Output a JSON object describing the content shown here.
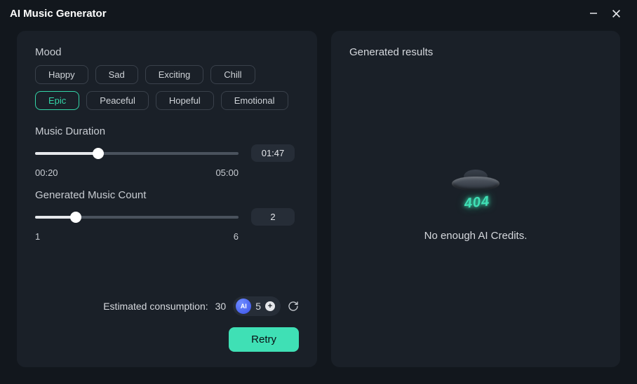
{
  "window": {
    "title": "AI Music Generator"
  },
  "mood": {
    "label": "Mood",
    "options": [
      {
        "label": "Happy",
        "selected": false
      },
      {
        "label": "Sad",
        "selected": false
      },
      {
        "label": "Exciting",
        "selected": false
      },
      {
        "label": "Chill",
        "selected": false
      },
      {
        "label": "Epic",
        "selected": true
      },
      {
        "label": "Peaceful",
        "selected": false
      },
      {
        "label": "Hopeful",
        "selected": false
      },
      {
        "label": "Emotional",
        "selected": false
      }
    ]
  },
  "duration": {
    "label": "Music Duration",
    "min_label": "00:20",
    "max_label": "05:00",
    "value_label": "01:47",
    "percent": 31
  },
  "count": {
    "label": "Generated Music Count",
    "min_label": "1",
    "max_label": "6",
    "value_label": "2",
    "percent": 20
  },
  "footer": {
    "consumption_label": "Estimated consumption:",
    "consumption_value": "30",
    "credits": "5",
    "ai_badge": "AI",
    "retry_label": "Retry"
  },
  "results": {
    "title": "Generated results",
    "error_code": "404",
    "error_message": "No enough AI Credits."
  }
}
